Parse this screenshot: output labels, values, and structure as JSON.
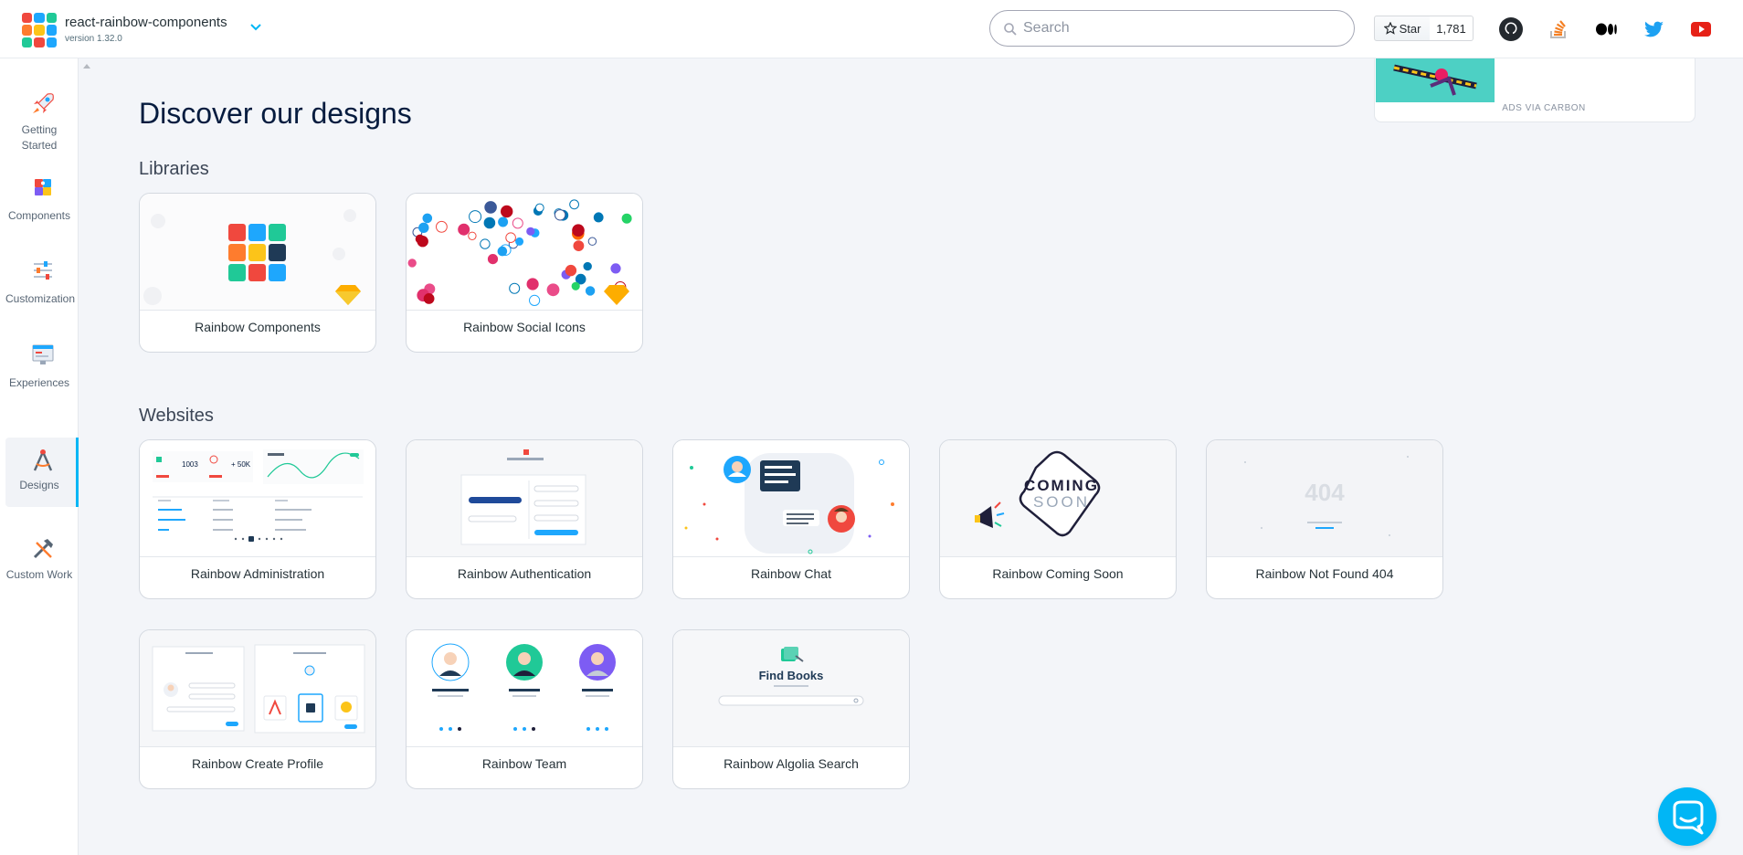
{
  "header": {
    "app_name": "react-rainbow-components",
    "version": "version 1.32.0",
    "search_placeholder": "Search",
    "star_label": "Star",
    "star_count": "1,781"
  },
  "sidebar": {
    "items": [
      {
        "label": "Getting Started",
        "icon": "rocket-icon"
      },
      {
        "label": "Components",
        "icon": "puzzle-icon"
      },
      {
        "label": "Customization",
        "icon": "sliders-icon"
      },
      {
        "label": "Experiences",
        "icon": "monitor-icon"
      },
      {
        "label": "Designs",
        "icon": "compass-icon",
        "active": true
      },
      {
        "label": "Custom Work",
        "icon": "tools-icon"
      }
    ]
  },
  "main": {
    "title": "Discover our designs",
    "libraries": {
      "heading": "Libraries",
      "cards": [
        {
          "label": "Rainbow Components"
        },
        {
          "label": "Rainbow Social Icons"
        }
      ]
    },
    "websites": {
      "heading": "Websites",
      "cards": [
        {
          "label": "Rainbow Administration"
        },
        {
          "label": "Rainbow Authentication"
        },
        {
          "label": "Rainbow Chat"
        },
        {
          "label": "Rainbow Coming Soon"
        },
        {
          "label": "Rainbow Not Found 404"
        },
        {
          "label": "Rainbow Create Profile"
        },
        {
          "label": "Rainbow Team"
        },
        {
          "label": "Rainbow Algolia Search"
        }
      ]
    }
  },
  "thumbs": {
    "admin_stat_1": "1003",
    "admin_stat_2": "+ 50K",
    "coming_soon_1": "COMING",
    "coming_soon_2": "SOON",
    "not_found": "404",
    "find_books": "Find Books"
  },
  "ad": {
    "label": "ADS VIA CARBON"
  },
  "colors": {
    "accent": "#01b6f5",
    "background": "#f3f5f9"
  }
}
